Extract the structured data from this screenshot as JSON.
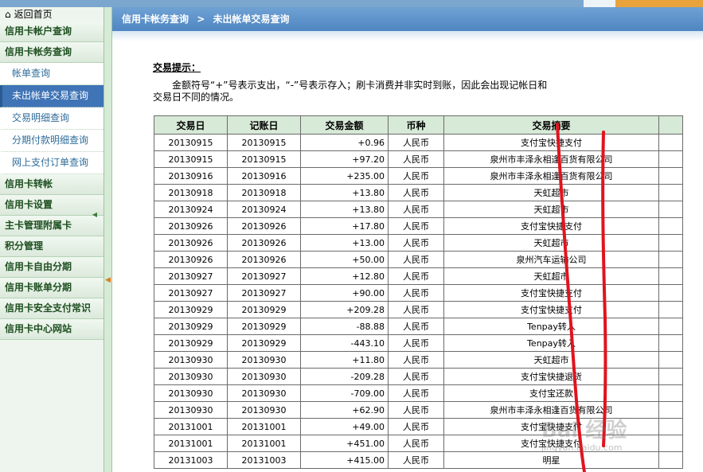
{
  "home": {
    "label": "返回首页"
  },
  "sidebar": {
    "items": [
      {
        "label": "信用卡帐户查询",
        "type": "item"
      },
      {
        "label": "信用卡帐务查询",
        "type": "item"
      },
      {
        "label": "帐单查询",
        "type": "sub"
      },
      {
        "label": "未出帐单交易查询",
        "type": "sub",
        "active": true
      },
      {
        "label": "交易明细查询",
        "type": "sub"
      },
      {
        "label": "分期付款明细查询",
        "type": "sub"
      },
      {
        "label": "网上支付订单查询",
        "type": "sub"
      },
      {
        "label": "信用卡转帐",
        "type": "item"
      },
      {
        "label": "信用卡设置",
        "type": "item"
      },
      {
        "label": "主卡管理附属卡",
        "type": "item"
      },
      {
        "label": "积分管理",
        "type": "item"
      },
      {
        "label": "信用卡自由分期",
        "type": "item"
      },
      {
        "label": "信用卡账单分期",
        "type": "item"
      },
      {
        "label": "信用卡安全支付常识",
        "type": "item"
      },
      {
        "label": "信用卡中心网站",
        "type": "item"
      }
    ]
  },
  "breadcrumb": {
    "parent": "信用卡帐务查询",
    "separator": ">",
    "current": "未出帐单交易查询"
  },
  "tip": {
    "title": "交易提示：",
    "line1": "金额符号“+”号表示支出，“-”号表示存入；刷卡消费并非实时到账，因此会出现记帐日和",
    "line2": "交易日不同的情况。"
  },
  "table": {
    "headers": [
      "交易日",
      "记账日",
      "交易金额",
      "币种",
      "交易摘要"
    ],
    "rows": [
      [
        "20130915",
        "20130915",
        "+0.96",
        "人民币",
        "支付宝快捷支付"
      ],
      [
        "20130915",
        "20130915",
        "+97.20",
        "人民币",
        "泉州市丰泽永相逢百货有限公司"
      ],
      [
        "20130916",
        "20130916",
        "+235.00",
        "人民币",
        "泉州市丰泽永相逢百货有限公司"
      ],
      [
        "20130918",
        "20130918",
        "+13.80",
        "人民币",
        "天虹超市"
      ],
      [
        "20130924",
        "20130924",
        "+13.80",
        "人民币",
        "天虹超市"
      ],
      [
        "20130926",
        "20130926",
        "+17.80",
        "人民币",
        "支付宝快捷支付"
      ],
      [
        "20130926",
        "20130926",
        "+13.00",
        "人民币",
        "天虹超市"
      ],
      [
        "20130926",
        "20130926",
        "+50.00",
        "人民币",
        "泉州汽车运输公司"
      ],
      [
        "20130927",
        "20130927",
        "+12.80",
        "人民币",
        "天虹超市"
      ],
      [
        "20130927",
        "20130927",
        "+90.00",
        "人民币",
        "支付宝快捷支付"
      ],
      [
        "20130929",
        "20130929",
        "+209.28",
        "人民币",
        "支付宝快捷支付"
      ],
      [
        "20130929",
        "20130929",
        "-88.88",
        "人民币",
        "Tenpay转入"
      ],
      [
        "20130929",
        "20130929",
        "-443.10",
        "人民币",
        "Tenpay转入"
      ],
      [
        "20130930",
        "20130930",
        "+11.80",
        "人民币",
        "天虹超市"
      ],
      [
        "20130930",
        "20130930",
        "-209.28",
        "人民币",
        "支付宝快捷退货"
      ],
      [
        "20130930",
        "20130930",
        "-709.00",
        "人民币",
        "支付宝还款"
      ],
      [
        "20130930",
        "20130930",
        "+62.90",
        "人民币",
        "泉州市丰泽永相逢百货有限公司"
      ],
      [
        "20131001",
        "20131001",
        "+49.00",
        "人民币",
        "支付宝快捷支付"
      ],
      [
        "20131001",
        "20131001",
        "+451.00",
        "人民币",
        "支付宝快捷支付"
      ],
      [
        "20131003",
        "20131003",
        "+415.00",
        "人民币",
        "明星"
      ]
    ]
  },
  "watermark": {
    "brand": "Bai 经验",
    "url": "jingyan.baidu.com"
  },
  "colors": {
    "breadcrumb_bg": "#5a8fc8",
    "active_nav": "#3f74b6",
    "table_header_bg": "#d7e9d7",
    "annotation": "#e0141e"
  }
}
